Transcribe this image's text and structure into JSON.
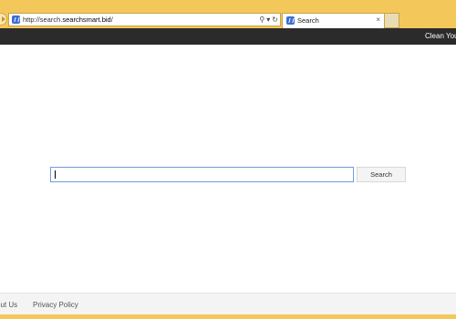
{
  "browser": {
    "url_prefix": "http://search.",
    "url_host": "searchsmart.bid",
    "url_suffix": "/",
    "tab_title": "Search",
    "tab_close": "×",
    "search_glyph": "⚲",
    "dropdown_glyph": "▾",
    "refresh_glyph": "↻"
  },
  "topbar": {
    "link": "Clean You"
  },
  "search": {
    "value": "",
    "button_label": "Search"
  },
  "footer": {
    "links": [
      "out Us",
      "Privacy Policy"
    ]
  },
  "colors": {
    "browser_frame": "#f3c75a",
    "topbar": "#2b2b2b",
    "input_border": "#6f9be0"
  }
}
